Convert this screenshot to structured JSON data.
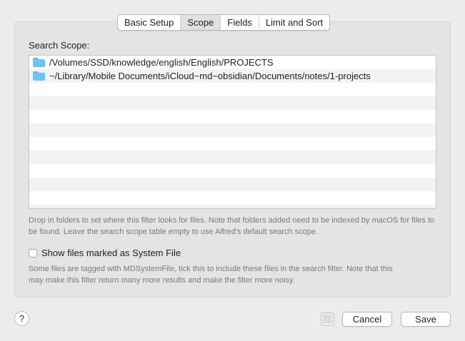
{
  "tabs": [
    {
      "label": "Basic Setup",
      "selected": false
    },
    {
      "label": "Scope",
      "selected": true
    },
    {
      "label": "Fields",
      "selected": false
    },
    {
      "label": "Limit and Sort",
      "selected": false
    }
  ],
  "scope": {
    "label": "Search Scope:",
    "paths": [
      "/Volumes/SSD/knowledge/english/English/PROJECTS",
      "~/Library/Mobile Documents/iCloud~md~obsidian/Documents/notes/1-projects"
    ],
    "help": "Drop in folders to set where this filter looks for files. Note that folders added need to be indexed by macOS for files to be found. Leave the search scope table empty to use Alfred's default search scope."
  },
  "system_file": {
    "label": "Show files marked as System File",
    "checked": false,
    "help": "Some files are tagged with MDSystemFile, tick this to include these files in the search filter. Note that this may make this filter return many more results and make the filter more noisy."
  },
  "footer": {
    "help_label": "?",
    "cancel_label": "Cancel",
    "save_label": "Save"
  }
}
